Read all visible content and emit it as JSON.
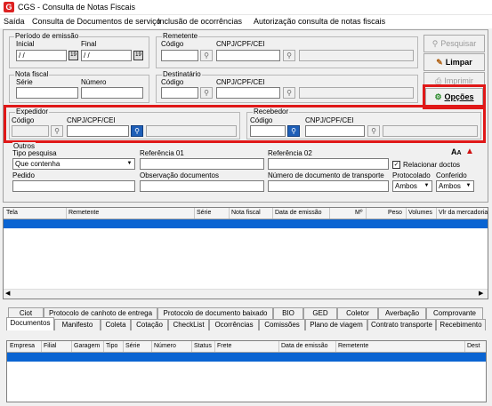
{
  "window": {
    "title": "CGS - Consulta de Notas Fiscais"
  },
  "menu": [
    "Saída",
    "Consulta de Documentos de serviço",
    "Inclusão de ocorrências",
    "Autorização consulta de notas fiscais"
  ],
  "periodo": {
    "legend": "Período de emissão",
    "inicial_label": "Inicial",
    "final_label": "Final",
    "inicial_value": " / /",
    "final_value": " / /",
    "cal_glyph": "19"
  },
  "remetente": {
    "legend": "Remetente",
    "codigo_label": "Código",
    "cnpj_label": "CNPJ/CPF/CEI"
  },
  "nota": {
    "legend": "Nota fiscal",
    "serie_label": "Série",
    "numero_label": "Número"
  },
  "destinatario": {
    "legend": "Destinatário",
    "codigo_label": "Código",
    "cnpj_label": "CNPJ/CPF/CEI"
  },
  "expedidor": {
    "legend": "Expedidor",
    "codigo_label": "Código",
    "cnpj_label": "CNPJ/CPF/CEI"
  },
  "recebedor": {
    "legend": "Recebedor",
    "codigo_label": "Código",
    "cnpj_label": "CNPJ/CPF/CEI"
  },
  "buttons": {
    "pesquisar": "Pesquisar",
    "limpar": "Limpar",
    "imprimir": "Imprimir",
    "opcoes": "Opções"
  },
  "outros": {
    "legend": "Outros",
    "tipo_label": "Tipo pesquisa",
    "tipo_value": "Que contenha",
    "ref1_label": "Referência 01",
    "ref2_label": "Referência 02",
    "relacionar_label": "Relacionar doctos",
    "pedido_label": "Pedido",
    "obs_label": "Observação documentos",
    "numdoc_label": "Número de documento de transporte",
    "protocolado_label": "Protocolado",
    "protocolado_value": "Ambos",
    "conferido_label": "Conferido",
    "conferido_value": "Ambos"
  },
  "main_grid": {
    "columns": [
      "Tela",
      "Remetente",
      "Série",
      "Nota fiscal",
      "Data de emissão",
      "Mº",
      "Peso",
      "Volumes",
      "Vlr da mercadoria"
    ]
  },
  "tabs_row1": [
    "Ciot",
    "Protocolo de canhoto de entrega",
    "Protocolo de documento baixado",
    "BIO",
    "GED",
    "Coletor",
    "Averbação",
    "Comprovante"
  ],
  "tabs_row2": [
    "Documentos",
    "Manifesto",
    "Coleta",
    "Cotação",
    "CheckList",
    "Ocorrências",
    "Comissões",
    "Plano de viagem",
    "Contrato transporte",
    "Recebimento"
  ],
  "bottom_grid": {
    "columns": [
      "Empresa",
      "Filial",
      "Garagem",
      "Tipo",
      "Série",
      "Número",
      "Status",
      "Frete",
      "Data de emissão",
      "Remetente",
      "Dest"
    ]
  },
  "icons": {
    "search": "binoculars-icon",
    "app": "cgs-logo-icon"
  }
}
